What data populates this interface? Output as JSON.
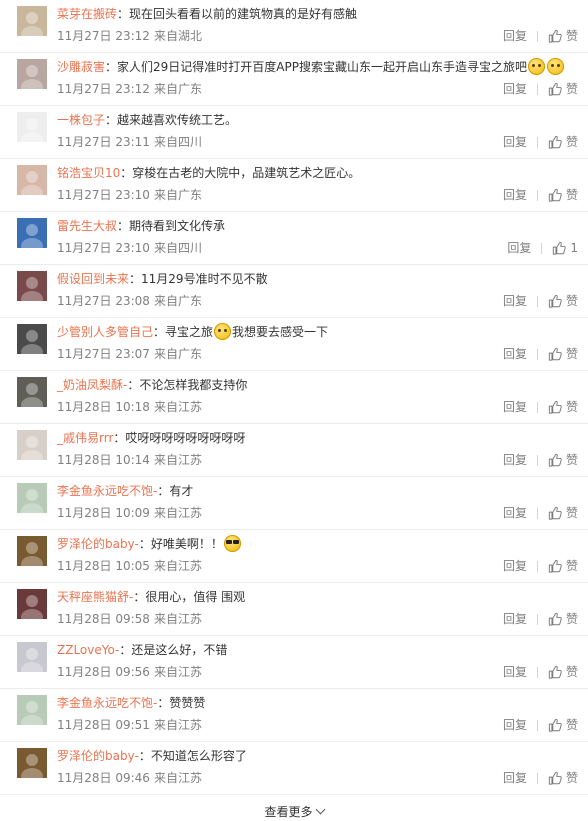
{
  "labels": {
    "reply": "回复",
    "like_default": "赞",
    "load_more": "查看更多"
  },
  "comments": [
    {
      "user": "菜芽在搬砖",
      "text": "现在回头看看以前的建筑物真的是好有感触",
      "time": "11月27日 23:12",
      "location": "来自湖北",
      "likes": "",
      "avatar_color": "#c9b79c",
      "emojis": []
    },
    {
      "user": "沙雕菽害",
      "text": "家人们29日记得准时打开百度APP搜索宝藏山东一起开启山东手造寻宝之旅吧",
      "time": "11月27日 23:12",
      "location": "来自广东",
      "likes": "",
      "avatar_color": "#b9a6a0",
      "emojis": [
        "cat",
        "cat"
      ]
    },
    {
      "user": "一株包子",
      "text": "越来越喜欢传统工艺。",
      "time": "11月27日 23:11",
      "location": "来自四川",
      "likes": "",
      "avatar_color": "#eeeeee",
      "emojis": []
    },
    {
      "user": "铭浩宝贝10",
      "text": "穿梭在古老的大院中，品建筑艺术之匠心。",
      "time": "11月27日 23:10",
      "location": "来自广东",
      "likes": "",
      "avatar_color": "#d6b7a8",
      "emojis": []
    },
    {
      "user": "雷先生大叔",
      "text": "期待看到文化传承",
      "time": "11月27日 23:10",
      "location": "来自四川",
      "likes": "1",
      "avatar_color": "#3a6fb5",
      "emojis": []
    },
    {
      "user": "假设回到未来",
      "text": "11月29号准时不见不散",
      "time": "11月27日 23:08",
      "location": "来自广东",
      "likes": "",
      "avatar_color": "#7a4a4a",
      "emojis": []
    },
    {
      "user": "少管别人多管自己",
      "text_before": "寻宝之旅",
      "text": "我想要去感受一下",
      "time": "11月27日 23:07",
      "location": "来自广东",
      "likes": "",
      "avatar_color": "#4a4a4a",
      "emojis": [
        "cat"
      ]
    },
    {
      "user": "_奶油凤梨酥-",
      "text": "不论怎样我都支持你",
      "time": "11月28日 10:18",
      "location": "来自江苏",
      "likes": "",
      "avatar_color": "#5f5f58",
      "emojis": []
    },
    {
      "user": "_戚伟易rrr",
      "text": "哎呀呀呀呀呀呀呀呀呀",
      "time": "11月28日 10:14",
      "location": "来自江苏",
      "likes": "",
      "avatar_color": "#d8cfc8",
      "emojis": []
    },
    {
      "user": "李金鱼永远吃不饱-",
      "text": "有才",
      "time": "11月28日 10:09",
      "location": "来自江苏",
      "likes": "",
      "avatar_color": "#b7cbb7",
      "emojis": []
    },
    {
      "user": "罗泽伦的baby-",
      "text": "好唯美啊！！",
      "time": "11月28日 10:05",
      "location": "来自江苏",
      "likes": "",
      "avatar_color": "#7a5a30",
      "emojis": [
        "cool"
      ]
    },
    {
      "user": "天秤座熊猫舒-",
      "text": "很用心，值得 围观",
      "time": "11月28日 09:58",
      "location": "来自江苏",
      "likes": "",
      "avatar_color": "#6a3a3a",
      "emojis": []
    },
    {
      "user": "ZZLoveYo-",
      "text": "还是这么好，不错",
      "time": "11月28日 09:56",
      "location": "来自江苏",
      "likes": "",
      "avatar_color": "#c8c8d0",
      "emojis": []
    },
    {
      "user": "李金鱼永远吃不饱-",
      "text": "赞赞赞",
      "time": "11月28日 09:51",
      "location": "来自江苏",
      "likes": "",
      "avatar_color": "#b7cbb7",
      "emojis": []
    },
    {
      "user": "罗泽伦的baby-",
      "text": "不知道怎么形容了",
      "time": "11月28日 09:46",
      "location": "来自江苏",
      "likes": "",
      "avatar_color": "#7a5a30",
      "emojis": []
    }
  ]
}
